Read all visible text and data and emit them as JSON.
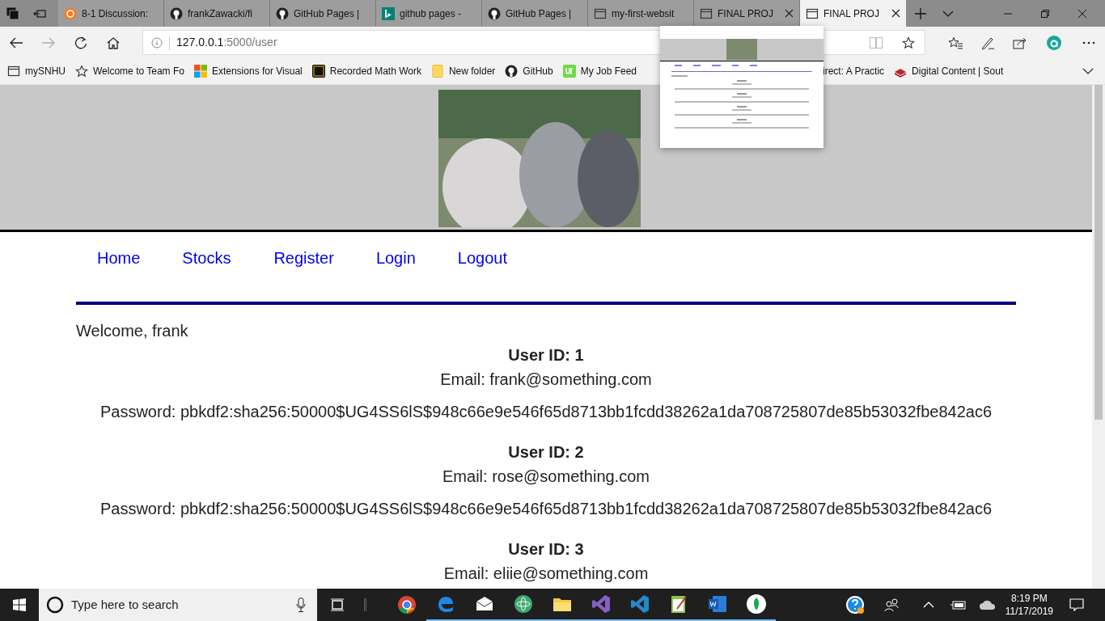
{
  "browser": {
    "tabs": [
      {
        "title": "8-1 Discussion:",
        "kind": "brightspace",
        "selected": false,
        "closable": false
      },
      {
        "title": "frankZawacki/fi",
        "kind": "github",
        "selected": false,
        "closable": false
      },
      {
        "title": "GitHub Pages |",
        "kind": "github",
        "selected": false,
        "closable": false
      },
      {
        "title": "github pages -",
        "kind": "bing",
        "selected": false,
        "closable": false
      },
      {
        "title": "GitHub Pages |",
        "kind": "github",
        "selected": false,
        "closable": false
      },
      {
        "title": "my-first-websit",
        "kind": "page",
        "selected": false,
        "closable": false
      },
      {
        "title": "FINAL PROJ",
        "kind": "page",
        "selected": false,
        "closable": true
      },
      {
        "title": "FINAL PROJ",
        "kind": "page",
        "selected": true,
        "closable": true
      }
    ],
    "address": {
      "host": "127.0.0.1",
      "path": ":5000/user"
    },
    "bookmarks": [
      {
        "label": "mySNHU",
        "kind": "page"
      },
      {
        "label": "Welcome to Team Fo",
        "kind": "star"
      },
      {
        "label": "Extensions for Visual",
        "kind": "windows"
      },
      {
        "label": "Recorded Math Work",
        "kind": "sp"
      },
      {
        "label": "New folder",
        "kind": "folder"
      },
      {
        "label": "GitHub",
        "kind": "github"
      },
      {
        "label": "My Job Feed",
        "kind": "upwork"
      },
      {
        "label": "irect: A Practic",
        "kind": "plain"
      },
      {
        "label": "Digital Content | Sout",
        "kind": "books"
      }
    ]
  },
  "page": {
    "nav": [
      "Home",
      "Stocks",
      "Register",
      "Login",
      "Logout"
    ],
    "welcome": "Welcome, frank",
    "users": [
      {
        "id": "User ID: 1",
        "email": "Email: frank@something.com",
        "password": "Password: pbkdf2:sha256:50000$UG4SS6lS$948c66e9e546f65d8713bb1fcdd38262a1da708725807de85b53032fbe842ac6"
      },
      {
        "id": "User ID: 2",
        "email": "Email: rose@something.com",
        "password": "Password: pbkdf2:sha256:50000$UG4SS6lS$948c66e9e546f65d8713bb1fcdd38262a1da708725807de85b53032fbe842ac6"
      },
      {
        "id": "User ID: 3",
        "email": "Email: eliie@something.com"
      }
    ]
  },
  "taskbar": {
    "search_placeholder": "Type here to search",
    "time": "8:19 PM",
    "date": "11/17/2019"
  }
}
